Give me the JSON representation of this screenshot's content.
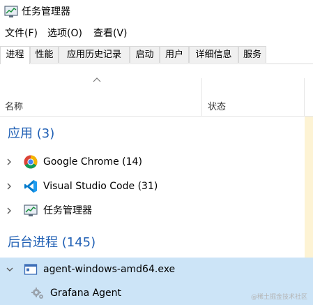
{
  "window": {
    "title": "任务管理器"
  },
  "menu": [
    "文件(F)",
    "选项(O)",
    "查看(V)"
  ],
  "tabs": [
    "进程",
    "性能",
    "应用历史记录",
    "启动",
    "用户",
    "详细信息",
    "服务"
  ],
  "columns": {
    "name": "名称",
    "status": "状态"
  },
  "groups": {
    "apps": {
      "title": "应用 (3)",
      "items": [
        {
          "label": "Google Chrome (14)",
          "icon": "chrome-icon"
        },
        {
          "label": "Visual Studio Code (31)",
          "icon": "vscode-icon"
        },
        {
          "label": "任务管理器",
          "icon": "task-manager-icon"
        }
      ]
    },
    "background": {
      "title": "后台进程 (145)",
      "items": [
        {
          "label": "agent-windows-amd64.exe",
          "icon": "exe-window-icon",
          "expanded": true
        },
        {
          "label": "Grafana Agent",
          "icon": "gear-icon",
          "child": true
        }
      ]
    }
  },
  "watermark": "@稀土掘金技术社区",
  "colors": {
    "accent": "#1f5fb4",
    "selected_row": "#cce4f7",
    "status_column": "#fdf3d4"
  }
}
